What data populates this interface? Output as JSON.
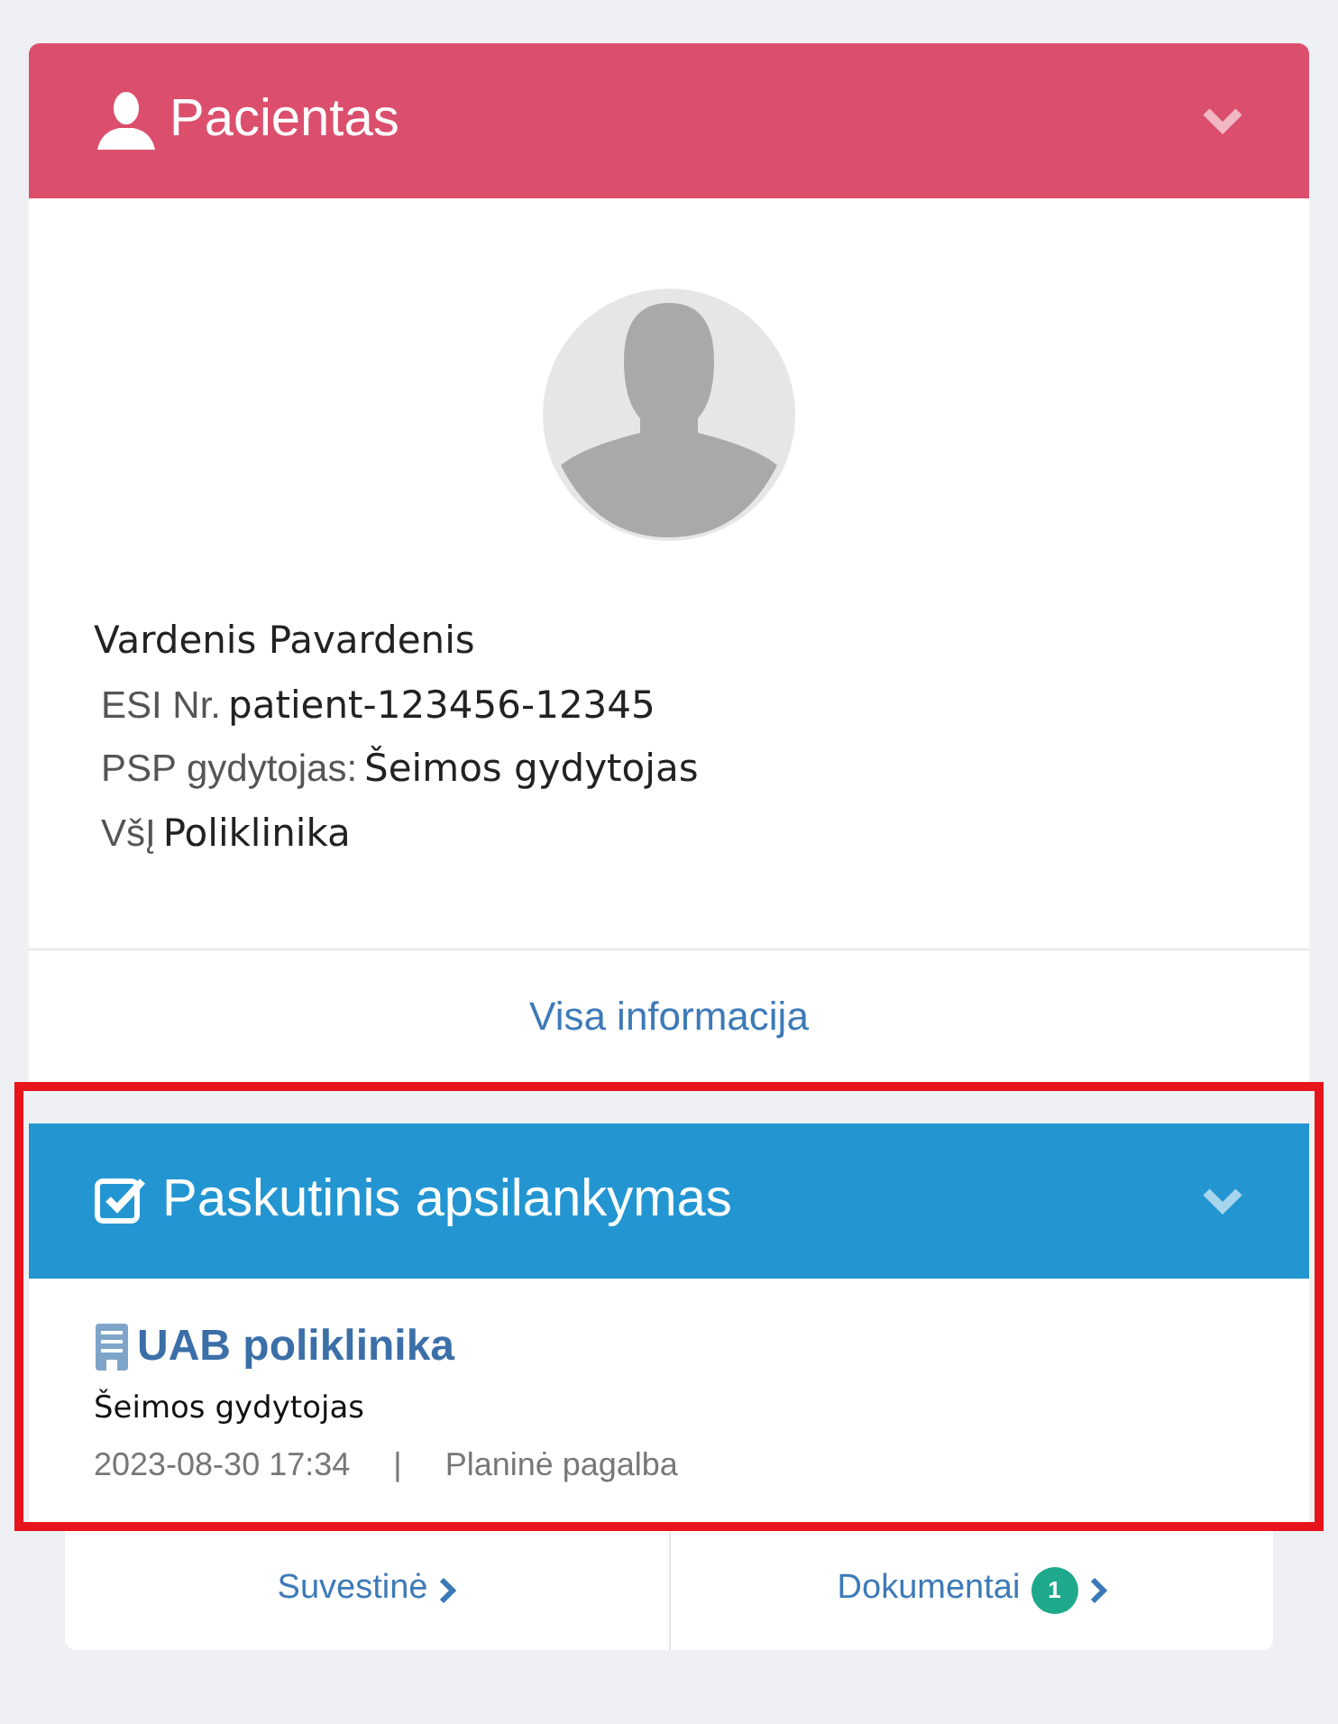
{
  "patient_panel": {
    "title": "Pacientas",
    "expanded": true,
    "name": "Vardenis Pavardenis",
    "fields": [
      {
        "label": "ESI Nr.",
        "value": "patient-123456-12345"
      },
      {
        "label": "PSP gydytojas:",
        "value": "Šeimos gydytojas"
      },
      {
        "label": "VšĮ",
        "value": "Poliklinika"
      }
    ],
    "link": "Visa informacija"
  },
  "last_visit_panel": {
    "title": "Paskutinis apsilankymas",
    "expanded": true,
    "highlighted": true,
    "institution": "UAB poliklinika",
    "specialist": "Šeimos gydytojas",
    "datetime": "2023-08-30 17:34",
    "separator": "|",
    "care_type": "Planinė pagalba"
  },
  "footer_links": [
    {
      "label": "Suvestinė"
    },
    {
      "label": "Dokumentai",
      "badge": "1"
    }
  ]
}
